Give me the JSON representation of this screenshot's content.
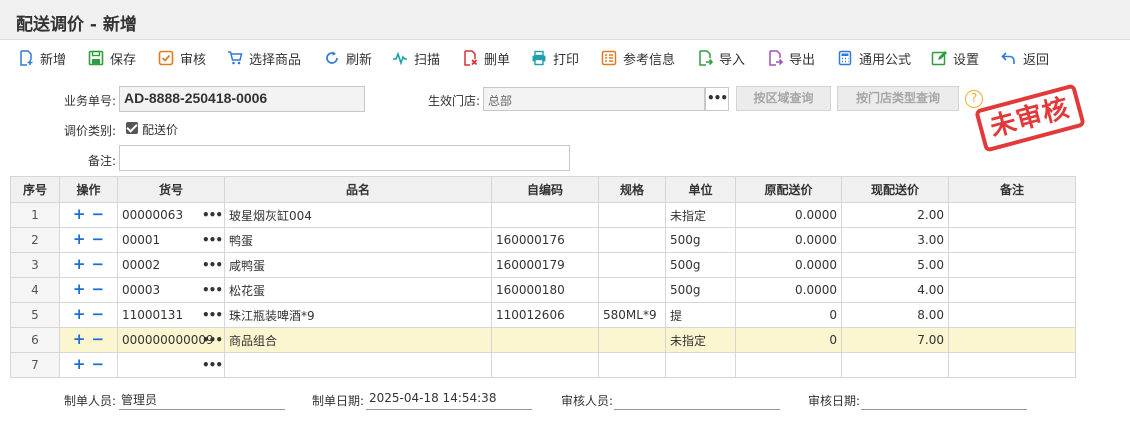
{
  "page": {
    "title": "配送调价 - 新增"
  },
  "toolbar": [
    {
      "label": "新增",
      "icon": "add-doc-icon"
    },
    {
      "label": "保存",
      "icon": "save-icon"
    },
    {
      "label": "审核",
      "icon": "approve-icon"
    },
    {
      "label": "选择商品",
      "icon": "cart-icon"
    },
    {
      "label": "刷新",
      "icon": "refresh-icon"
    },
    {
      "label": "扫描",
      "icon": "scan-icon"
    },
    {
      "label": "删单",
      "icon": "delete-doc-icon"
    },
    {
      "label": "打印",
      "icon": "printer-icon"
    },
    {
      "label": "参考信息",
      "icon": "info-list-icon"
    },
    {
      "label": "导入",
      "icon": "import-icon"
    },
    {
      "label": "导出",
      "icon": "export-icon"
    },
    {
      "label": "通用公式",
      "icon": "calculator-icon"
    },
    {
      "label": "设置",
      "icon": "settings-edit-icon"
    },
    {
      "label": "返回",
      "icon": "back-arrow-icon"
    }
  ],
  "form": {
    "order_no_label": "业务单号:",
    "order_no": "AD-8888-250418-0006",
    "store_label": "生效门店:",
    "store_value": "总部",
    "dots": "•••",
    "btn_region": "按区域查询",
    "btn_store_type": "按门店类型查询",
    "help": "?",
    "category_label": "调价类别:",
    "category_value": "配送价",
    "category_checked": true,
    "remark_label": "备注:",
    "remark_value": ""
  },
  "stamp": "未审核",
  "table": {
    "headers": [
      "序号",
      "操作",
      "货号",
      "品名",
      "自编码",
      "规格",
      "单位",
      "原配送价",
      "现配送价",
      "备注"
    ],
    "rows": [
      {
        "idx": "1",
        "code": "00000063",
        "name": "玻星烟灰缸004",
        "selfcode": "",
        "spec": "",
        "unit": "未指定",
        "old_price": "0.0000",
        "new_price": "2.00",
        "remark": ""
      },
      {
        "idx": "2",
        "code": "00001",
        "name": "鸭蛋",
        "selfcode": "160000176",
        "spec": "",
        "unit": "500g",
        "old_price": "0.0000",
        "new_price": "3.00",
        "remark": ""
      },
      {
        "idx": "3",
        "code": "00002",
        "name": "咸鸭蛋",
        "selfcode": "160000179",
        "spec": "",
        "unit": "500g",
        "old_price": "0.0000",
        "new_price": "5.00",
        "remark": ""
      },
      {
        "idx": "4",
        "code": "00003",
        "name": "松花蛋",
        "selfcode": "160000180",
        "spec": "",
        "unit": "500g",
        "old_price": "0.0000",
        "new_price": "4.00",
        "remark": ""
      },
      {
        "idx": "5",
        "code": "11000131",
        "name": "珠江瓶装啤酒*9",
        "selfcode": "110012606",
        "spec": "580ML*9",
        "unit": "提",
        "old_price": "0",
        "new_price": "8.00",
        "remark": ""
      },
      {
        "idx": "6",
        "code": "000000000009",
        "name": "商品组合",
        "selfcode": "",
        "spec": "",
        "unit": "未指定",
        "old_price": "0",
        "new_price": "7.00",
        "remark": "",
        "selected": true
      },
      {
        "idx": "7",
        "code": "",
        "name": "",
        "selfcode": "",
        "spec": "",
        "unit": "",
        "old_price": "",
        "new_price": "",
        "remark": ""
      }
    ],
    "plus": "+",
    "minus": "−"
  },
  "footer": {
    "maker_label": "制单人员:",
    "maker": "管理员",
    "date_label": "制单日期:",
    "date": "2025-04-18 14:54:38",
    "auditor_label": "审核人员:",
    "auditor": "",
    "audit_date_label": "审核日期:",
    "audit_date": ""
  },
  "colors": {
    "stamp": "#e02a2a",
    "selected_row": "#fbf5d0",
    "accent_blue": "#1a6fd0"
  }
}
